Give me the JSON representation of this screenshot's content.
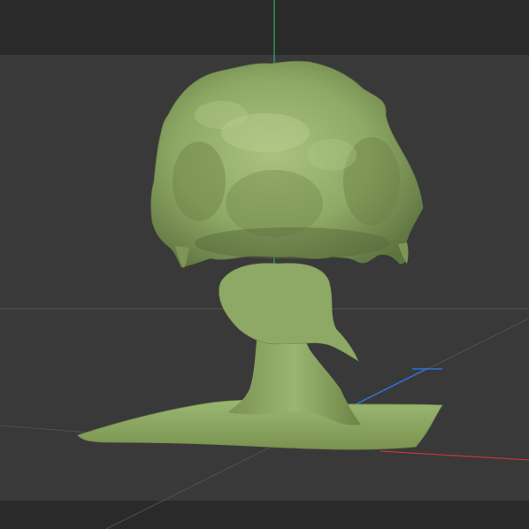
{
  "viewport": {
    "background": "#393939",
    "header_bar_color": "#2a2a2a",
    "footer_bar_color": "#2a2a2a",
    "grid_color": "#555555"
  },
  "axes": {
    "x_axis_color": "#c0393b",
    "y_axis_color": "#2f6fd6",
    "z_axis_color": "#2fae63"
  },
  "model": {
    "name_icon": "sculpted-tree-mesh",
    "base_color": "#8fa866",
    "shadow_color": "#5f7440",
    "highlight_color": "#b1c98a"
  }
}
